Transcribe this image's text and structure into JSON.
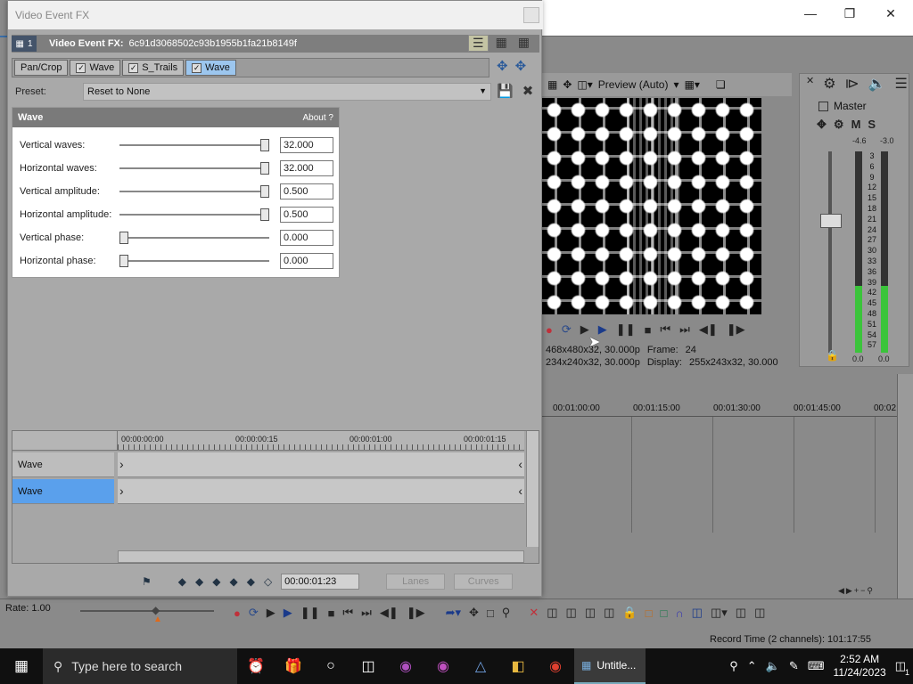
{
  "background_app": {
    "preview_mode": "Preview (Auto)",
    "preview_info": {
      "line1_left": "468x480x32, 30.000p",
      "line1_frame_label": "Frame:",
      "line1_frame_value": "24",
      "line2_left": "234x240x32, 30.000p",
      "line2_display_label": "Display:",
      "line2_display_value": "255x243x32, 30.000"
    },
    "mixer": {
      "title": "Master",
      "m_label": "M",
      "s_label": "S",
      "peak_left": "-4.6",
      "peak_right": "-3.0",
      "meter_scale": [
        "3",
        "6",
        "9",
        "12",
        "15",
        "18",
        "21",
        "24",
        "27",
        "30",
        "33",
        "36",
        "39",
        "42",
        "45",
        "48",
        "51",
        "54",
        "57"
      ],
      "bottom_left": "0.0",
      "bottom_right": "0.0",
      "level_left_fraction": 0.33,
      "level_right_fraction": 0.33
    },
    "timeline_ruler": [
      "00:01:00:00",
      "00:01:15:00",
      "00:01:30:00",
      "00:01:45:00",
      "00:02"
    ],
    "rate_label": "Rate: 1.00",
    "record_time": "Record Time (2 channels): 101:17:55"
  },
  "dialog": {
    "title": "Video Event FX",
    "fx_header": {
      "badge": "1",
      "label": "Video Event FX:",
      "id": "6c91d3068502c93b1955b1fa21b8149f"
    },
    "chain": [
      {
        "label": "Pan/Crop",
        "checked": false,
        "selected": false
      },
      {
        "label": "Wave",
        "checked": true,
        "selected": false
      },
      {
        "label": "S_Trails",
        "checked": true,
        "selected": false
      },
      {
        "label": "Wave",
        "checked": true,
        "selected": true
      }
    ],
    "preset_label": "Preset:",
    "preset_value": "Reset to None",
    "plugin_panel": {
      "title": "Wave",
      "about": "About  ?",
      "params": [
        {
          "label": "Vertical waves:",
          "value": "32.000",
          "slider_fraction": 1.0
        },
        {
          "label": "Horizontal waves:",
          "value": "32.000",
          "slider_fraction": 1.0
        },
        {
          "label": "Vertical amplitude:",
          "value": "0.500",
          "slider_fraction": 1.0
        },
        {
          "label": "Horizontal amplitude:",
          "value": "0.500",
          "slider_fraction": 1.0
        },
        {
          "label": "Vertical phase:",
          "value": "0.000",
          "slider_fraction": 0.0
        },
        {
          "label": "Horizontal phase:",
          "value": "0.000",
          "slider_fraction": 0.0
        }
      ]
    },
    "keyframes": {
      "ruler": [
        "00:00:00:00",
        "00:00:00:15",
        "00:00:01:00",
        "00:00:01:15"
      ],
      "rows": [
        {
          "label": "Wave",
          "selected": false
        },
        {
          "label": "Wave",
          "selected": true
        }
      ],
      "time": "00:00:01:23",
      "lanes_button": "Lanes",
      "curves_button": "Curves"
    }
  },
  "taskbar": {
    "search_placeholder": "Type here to search",
    "active_app": "Untitle...",
    "time": "2:52 AM",
    "date": "11/24/2023",
    "notification_count": "1"
  }
}
